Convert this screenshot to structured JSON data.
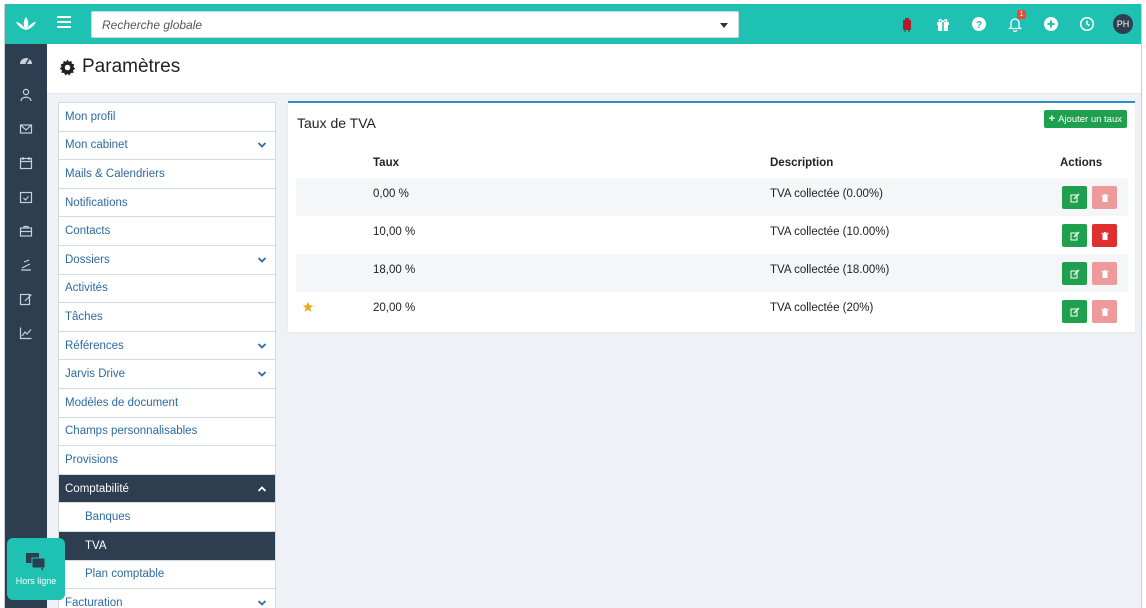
{
  "topbar": {
    "search_placeholder": "Recherche globale",
    "notification_count": "1",
    "user_initials": "PH"
  },
  "page": {
    "title": "Paramètres"
  },
  "menu": [
    {
      "label": "Mon profil",
      "chevron": ""
    },
    {
      "label": "Mon cabinet",
      "chevron": "down"
    },
    {
      "label": "Mails & Calendriers",
      "chevron": ""
    },
    {
      "label": "Notifications",
      "chevron": ""
    },
    {
      "label": "Contacts",
      "chevron": ""
    },
    {
      "label": "Dossiers",
      "chevron": "down"
    },
    {
      "label": "Activités",
      "chevron": ""
    },
    {
      "label": "Tâches",
      "chevron": ""
    },
    {
      "label": "Références",
      "chevron": "down"
    },
    {
      "label": "Jarvis Drive",
      "chevron": "down"
    },
    {
      "label": "Modèles de document",
      "chevron": ""
    },
    {
      "label": "Champs personnalisables",
      "chevron": ""
    },
    {
      "label": "Provisions",
      "chevron": ""
    },
    {
      "label": "Comptabilité",
      "chevron": "up",
      "active": true
    },
    {
      "label": "Banques",
      "chevron": "",
      "sub": true
    },
    {
      "label": "TVA",
      "chevron": "",
      "sub": true,
      "active": true
    },
    {
      "label": "Plan comptable",
      "chevron": "",
      "sub": true
    },
    {
      "label": "Facturation",
      "chevron": "down"
    }
  ],
  "panel": {
    "title": "Taux de TVA",
    "add_label": "Ajouter un taux",
    "columns": {
      "rate": "Taux",
      "description": "Description",
      "actions": "Actions"
    },
    "rows": [
      {
        "rate": "0,00 %",
        "description": "TVA collectée (0.00%)",
        "default": false,
        "delete_enabled": false
      },
      {
        "rate": "10,00 %",
        "description": "TVA collectée (10.00%)",
        "default": false,
        "delete_enabled": true
      },
      {
        "rate": "18,00 %",
        "description": "TVA collectée (18.00%)",
        "default": false,
        "delete_enabled": false
      },
      {
        "rate": "20,00 %",
        "description": "TVA collectée (20%)",
        "default": true,
        "delete_enabled": false
      }
    ]
  },
  "offline": {
    "label": "Hors ligne"
  },
  "colors": {
    "brand": "#1fc1b2",
    "sidebar": "#2d3e50",
    "accent_blue": "#2e8bc4",
    "success": "#1fa04e",
    "danger": "#e02f2f",
    "danger_disabled": "#ef9a9a",
    "star": "#f0a820"
  }
}
